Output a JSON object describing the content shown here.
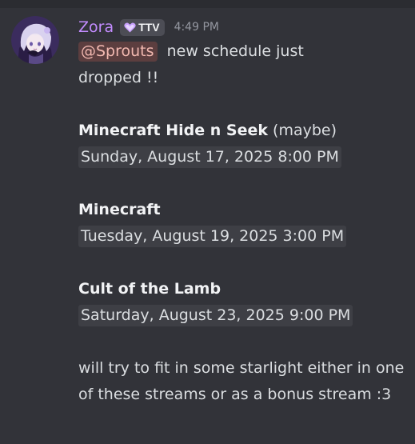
{
  "message": {
    "author": "Zora",
    "tag": {
      "icon": "heart-icon",
      "label": "TTV",
      "color": "#c38cff"
    },
    "timestamp": "4:49 PM",
    "mention": "@Sprouts",
    "intro_after_mention": "new schedule just",
    "intro_line2": "dropped !!",
    "events": [
      {
        "title": "Minecraft Hide n Seek",
        "note": "(maybe)",
        "datetime": "Sunday, August 17, 2025 8:00 PM"
      },
      {
        "title": "Minecraft",
        "note": "",
        "datetime": "Tuesday, August 19, 2025 3:00 PM"
      },
      {
        "title": "Cult of the Lamb",
        "note": "",
        "datetime": "Saturday, August 23, 2025 9:00 PM"
      }
    ],
    "outro": "will try to fit in some starlight either in one of these streams or as a bonus stream :3"
  },
  "colors": {
    "background": "#323339",
    "username": "#c38cff",
    "mention_text": "#f2b8b0",
    "mention_bg": "#5c3e3f",
    "timestamp_pill": "#3e3f45"
  }
}
